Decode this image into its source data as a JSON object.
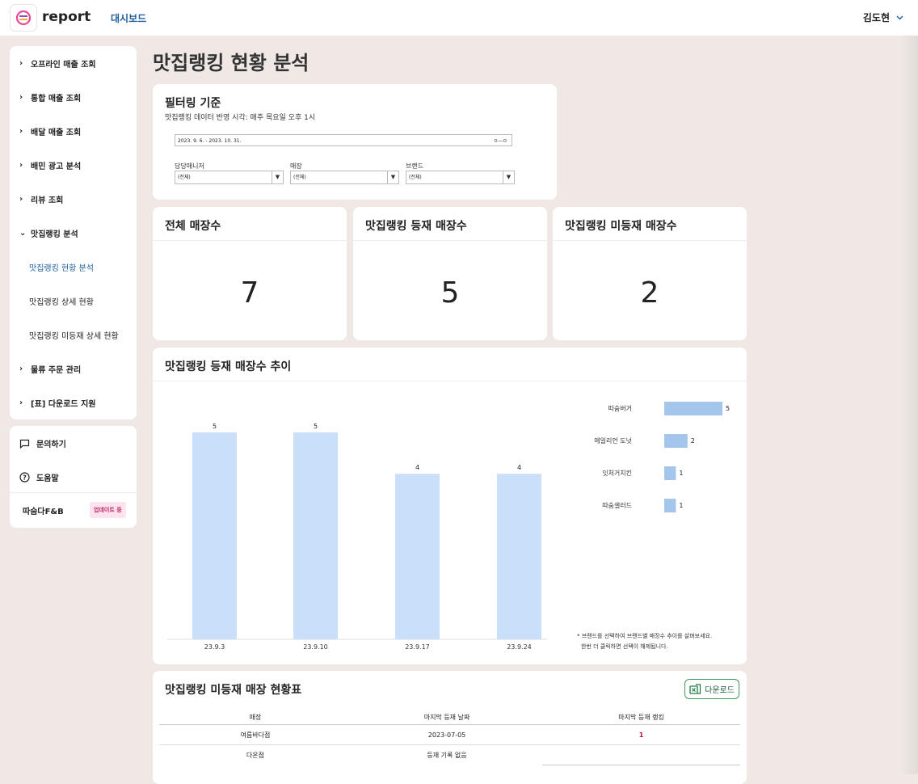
{
  "app": {
    "logo_text": "report",
    "nav_label": "대시보드",
    "user_name": "김도현"
  },
  "sidebar": {
    "items": [
      {
        "label": "오프라인 매출 조회",
        "chevron": "›"
      },
      {
        "label": "통합 매출 조회",
        "chevron": "›"
      },
      {
        "label": "배달 매출 조회",
        "chevron": "›"
      },
      {
        "label": "배민 광고 분석",
        "chevron": "›"
      },
      {
        "label": "리뷰 조회",
        "chevron": "›"
      },
      {
        "label": "맛집랭킹 분석",
        "chevron": "⌄"
      },
      {
        "label": "물류 주문 관리",
        "chevron": "›"
      },
      {
        "label": "[표] 다운로드 지원",
        "chevron": "›"
      }
    ],
    "subitems": [
      {
        "label": "맛집랭킹 현황 분석",
        "active": true
      },
      {
        "label": "맛집랭킹 상세 현황",
        "active": false
      },
      {
        "label": "맛집랭킹 미등재 상세 현황",
        "active": false
      }
    ],
    "support": [
      {
        "label": "문의하기",
        "icon": "chat-icon"
      },
      {
        "label": "도움말",
        "icon": "help-icon"
      }
    ],
    "company": "따숨다F&B",
    "company_badge": "업데이트 중"
  },
  "page": {
    "title": "맛집랭킹 현황 분석"
  },
  "filter": {
    "title": "필터링 기준",
    "subtitle": "맛집랭킹 데이터 반영 시각: 매주 목요일 오후 1시",
    "date_range": "2023. 9. 6. - 2023. 10. 31.",
    "selects": [
      {
        "label": "담당매니저",
        "value": "(전체)"
      },
      {
        "label": "매장",
        "value": "(전체)"
      },
      {
        "label": "브랜드",
        "value": "(전체)"
      }
    ]
  },
  "kpis": [
    {
      "title": "전체 매장수",
      "value": "7"
    },
    {
      "title": "맛집랭킹 등재 매장수",
      "value": "5"
    },
    {
      "title": "맛집랭킹 미등재 매장수",
      "value": "2"
    }
  ],
  "trend": {
    "title": "맛집랭킹 등재 매장수 추이",
    "note_line1": "* 브랜드를 선택하여 브랜드별 매장수 추이를 살펴보세요.",
    "note_line2": "한번 더 클릭하면 선택이 해제됩니다."
  },
  "chart_data": [
    {
      "type": "bar",
      "categories": [
        "23.9.3",
        "23.9.10",
        "23.9.17",
        "23.9.24"
      ],
      "values": [
        5,
        5,
        4,
        4
      ],
      "ylim": [
        0,
        5
      ],
      "colors": {
        "bar": "#cadffa"
      }
    },
    {
      "type": "bar",
      "orientation": "horizontal",
      "categories": [
        "따숨버거",
        "에일리언 도넛",
        "잇처거치킨",
        "따숨샐러드"
      ],
      "values": [
        5,
        2,
        1,
        1
      ],
      "colors": {
        "bar": "#a4c5ec"
      }
    }
  ],
  "table": {
    "title": "맛집랭킹 미등재 매장 현황표",
    "download_label": "다운로드",
    "columns": [
      "매장",
      "마지막 등재 날짜",
      "마지막 등재 랭킹"
    ],
    "rows": [
      [
        "여름바다점",
        "2023-07-05",
        "1"
      ],
      [
        "다온점",
        "등재 기록 없음",
        ""
      ]
    ]
  }
}
